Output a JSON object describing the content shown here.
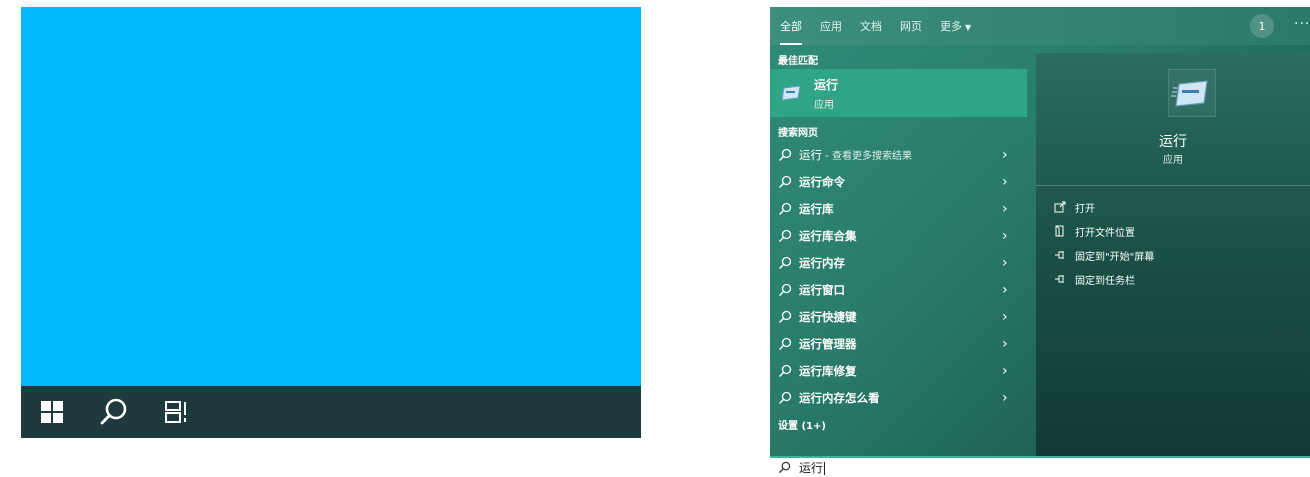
{
  "panel": {
    "tabs": [
      {
        "label": "全部"
      },
      {
        "label": "应用"
      },
      {
        "label": "文档"
      },
      {
        "label": "网页"
      },
      {
        "label": "更多"
      }
    ],
    "badge_count": "1",
    "more_menu": "···",
    "best_match_heading": "最佳匹配",
    "best_match": {
      "title": "运行",
      "subtitle": "应用"
    },
    "web_heading": "搜索网页",
    "web_results": [
      {
        "text": "运行",
        "suffix": " - 查看更多搜索结果"
      },
      {
        "text": "运行命令"
      },
      {
        "text": "运行库"
      },
      {
        "text": "运行库合集"
      },
      {
        "text": "运行内存"
      },
      {
        "text": "运行窗口"
      },
      {
        "text": "运行快捷键"
      },
      {
        "text": "运行管理器"
      },
      {
        "text": "运行库修复"
      },
      {
        "text": "运行内存怎么看"
      }
    ],
    "settings_heading": "设置 (1+)",
    "preview": {
      "title": "运行",
      "subtitle": "应用"
    },
    "actions": [
      {
        "label": "打开",
        "icon": "open-icon"
      },
      {
        "label": "打开文件位置",
        "icon": "file-location-icon"
      },
      {
        "label": "固定到\"开始\"屏幕",
        "icon": "pin-icon"
      },
      {
        "label": "固定到任务栏",
        "icon": "pin-icon"
      }
    ]
  },
  "search": {
    "query": "运行"
  },
  "taskbar": {
    "icons": [
      "windows-start-icon",
      "search-icon",
      "task-view-icon"
    ]
  },
  "colors": {
    "desktop": "#00b9fb",
    "taskbar": "#1e3a3c",
    "accent": "#2ea585"
  }
}
